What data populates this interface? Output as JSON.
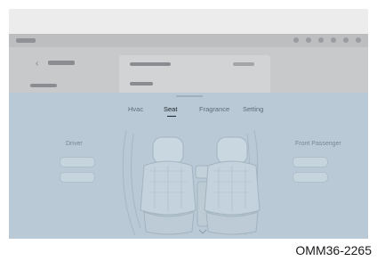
{
  "screen": {
    "tabs": [
      {
        "label": "Hvac",
        "active": false
      },
      {
        "label": "Seat",
        "active": true
      },
      {
        "label": "Fragrance",
        "active": false
      },
      {
        "label": "Setting",
        "active": false
      }
    ],
    "left_zone_label": "Driver",
    "right_zone_label": "Front Passenger"
  },
  "caption": "OMM36-2265",
  "colors": {
    "sheet": "#b9cad6",
    "active_tab_text": "#1d232a",
    "inactive_tab_text": "#5f6c77"
  }
}
